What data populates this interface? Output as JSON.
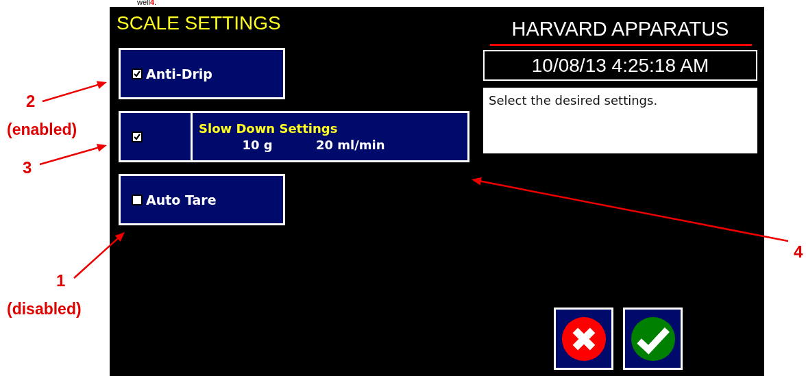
{
  "caption_fragment": {
    "text": "well",
    "ref": "4",
    "end": "."
  },
  "screen": {
    "title": "SCALE SETTINGS",
    "brand": "HARVARD APPARATUS",
    "datetime": "10/08/13 4:25:18 AM",
    "message": "Select the desired settings.",
    "settings": [
      {
        "kind": "toggle",
        "label": "Anti-Drip",
        "checked": true
      },
      {
        "kind": "split",
        "checked": true,
        "title": "Slow Down Settings",
        "weight": "10 g",
        "rate": "20 ml/min"
      },
      {
        "kind": "toggle",
        "label": "Auto Tare",
        "checked": false
      }
    ],
    "buttons": [
      {
        "kind": "cancel"
      },
      {
        "kind": "ok"
      }
    ]
  },
  "callouts": [
    {
      "number": "2",
      "note": "(enabled)"
    },
    {
      "number": "3"
    },
    {
      "number": "1",
      "note": "(disabled)"
    },
    {
      "number": "4"
    }
  ]
}
